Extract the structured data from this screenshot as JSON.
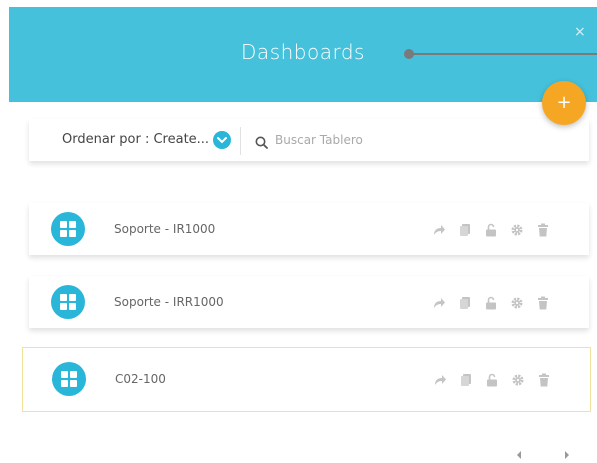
{
  "header": {
    "title": "Dashboards",
    "close_label": "×",
    "accent_color": "#45c1db"
  },
  "fab": {
    "label": "+",
    "color": "#f5a623"
  },
  "toolbar": {
    "sort_label": "Ordenar por : Create...",
    "search_placeholder": "Buscar Tablero",
    "search_value": ""
  },
  "dashboards": [
    {
      "name": "Soporte - IR1000",
      "icon": "dashboard-grid-icon",
      "selected": false
    },
    {
      "name": "Soporte - IRR1000",
      "icon": "dashboard-grid-icon",
      "selected": false
    },
    {
      "name": "C02-100",
      "icon": "dashboard-grid-icon",
      "selected": true
    }
  ],
  "row_action_icons": [
    "share-icon",
    "copy-icon",
    "lock-icon",
    "settings-icon",
    "delete-icon"
  ],
  "pager": {
    "prev_icon": "chevron-left-icon",
    "next_icon": "chevron-right-icon"
  }
}
